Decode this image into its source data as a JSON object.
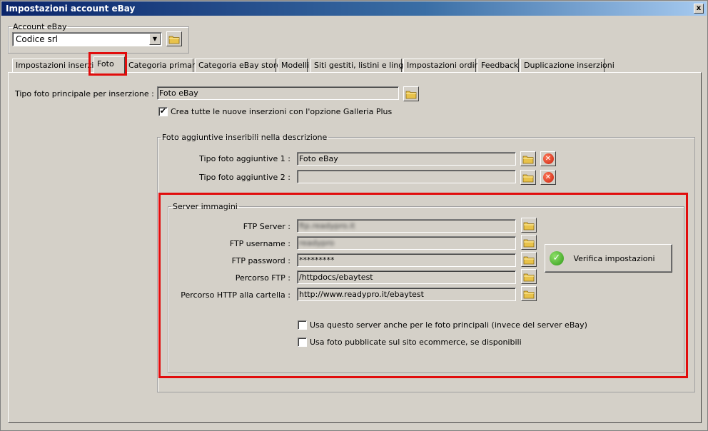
{
  "window": {
    "title": "Impostazioni account eBay",
    "close_glyph": "x"
  },
  "account": {
    "group_label": "Account eBay",
    "selected": "Codice srl"
  },
  "tabs": [
    {
      "label": "Impostazioni inserzioni"
    },
    {
      "label": "Foto",
      "active": true
    },
    {
      "label": "Categoria primaria"
    },
    {
      "label": "Categoria eBay store"
    },
    {
      "label": "Modelli"
    },
    {
      "label": "Siti gestiti, listini e lingue"
    },
    {
      "label": "Impostazioni ordini"
    },
    {
      "label": "Feedback"
    },
    {
      "label": "Duplicazione inserzioni"
    }
  ],
  "photo": {
    "main_type_label": "Tipo foto principale per inserzione :",
    "main_type_value": "Foto eBay",
    "gallery_plus_label": "Crea tutte le nuove inserzioni con l'opzione Galleria Plus",
    "gallery_plus_checked": true
  },
  "additional": {
    "group_label": "Foto aggiuntive inseribili nella descrizione",
    "type1_label": "Tipo foto aggiuntive 1 :",
    "type1_value": "Foto eBay",
    "type2_label": "Tipo foto aggiuntive 2 :",
    "type2_value": ""
  },
  "server": {
    "group_label": "Server immagini",
    "ftp_server_label": "FTP Server :",
    "ftp_server_value": "ftp.readypro.it",
    "ftp_username_label": "FTP username :",
    "ftp_username_value": "readypro",
    "ftp_password_label": "FTP password :",
    "ftp_password_value": "*********",
    "ftp_path_label": "Percorso FTP :",
    "ftp_path_value": "/httpdocs/ebaytest",
    "http_path_label": "Percorso HTTP alla cartella :",
    "http_path_value": "http://www.readypro.it/ebaytest",
    "verify_label": "Verifica impostazioni",
    "use_server_label": "Usa questo server anche per le foto principali (invece del server eBay)",
    "use_server_checked": false,
    "use_site_photos_label": "Usa foto pubblicate sul sito ecommerce, se disponibili",
    "use_site_photos_checked": false
  },
  "colors": {
    "highlight": "#e10c0c",
    "titlebar": "#0a246a",
    "face": "#d4d0c8"
  },
  "icons": {
    "browse": "folder-icon",
    "delete": "delete-icon",
    "verify": "check-icon"
  }
}
